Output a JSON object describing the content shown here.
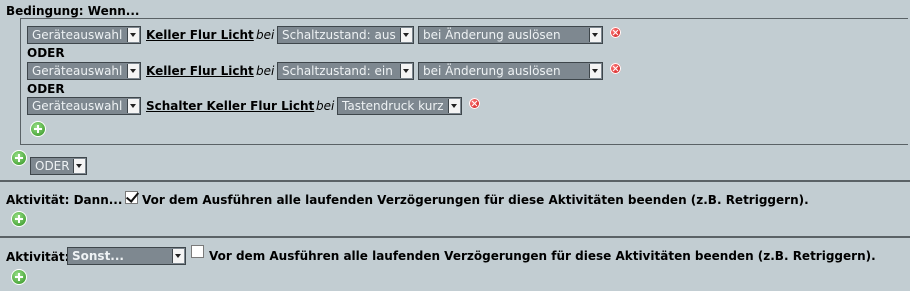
{
  "condition": {
    "title": "Bedingung: Wenn...",
    "rows": [
      {
        "type_select": "Geräteauswahl",
        "device": "Keller Flur Licht",
        "bei": "bei",
        "state_select": "Schaltzustand: aus",
        "trigger_select": "bei Änderung auslösen"
      },
      {
        "connector": "ODER",
        "type_select": "Geräteauswahl",
        "device": "Keller Flur Licht",
        "bei": "bei",
        "state_select": "Schaltzustand: ein",
        "trigger_select": "bei Änderung auslösen"
      },
      {
        "connector": "ODER",
        "type_select": "Geräteauswahl",
        "device": "Schalter Keller Flur Licht",
        "bei": "bei",
        "state_select": "Tastendruck kurz"
      }
    ],
    "logic_select": "ODER"
  },
  "activity_then": {
    "label": "Aktivität: Dann...",
    "checkbox_checked": true,
    "checkbox_label": "Vor dem Ausführen alle laufenden Verzögerungen für diese Aktivitäten beenden (z.B. Retriggern)."
  },
  "activity_else": {
    "label": "Aktivität:",
    "select": "Sonst...",
    "checkbox_checked": false,
    "checkbox_label": "Vor dem Ausführen alle laufenden Verzögerungen für diese Aktivitäten beenden (z.B. Retriggern)."
  },
  "icons": {
    "delete": "delete-icon",
    "add": "add-icon",
    "dropdown": "chevron-down-icon"
  },
  "colors": {
    "background": "#c2cdd2",
    "select_bg": "#7e8890",
    "delete_red": "#c40000",
    "add_green": "#2d8f1e"
  }
}
